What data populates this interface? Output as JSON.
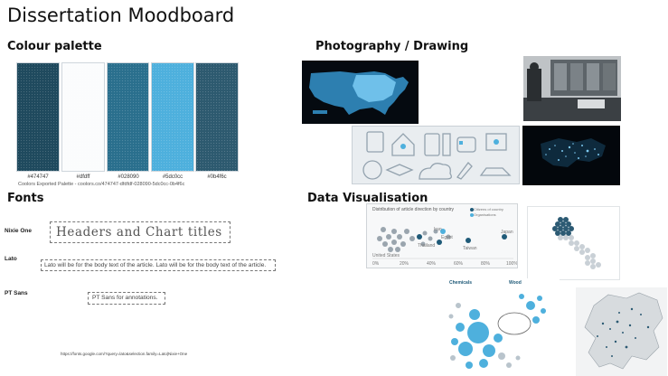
{
  "page": {
    "title": "Dissertation Moodboard"
  },
  "sections": {
    "colour_palette": "Colour palette",
    "photography": "Photography / Drawing",
    "fonts": "Fonts",
    "data_vis": "Data Visualisation"
  },
  "palette": {
    "swatches": [
      {
        "hex": "#1f4a5e",
        "label": "#474747"
      },
      {
        "hex": "#fbfcfd",
        "label": "#dfdff"
      },
      {
        "hex": "#2a6f8d",
        "label": "#028090"
      },
      {
        "hex": "#4eb0dd",
        "label": "#5dc0cc"
      },
      {
        "hex": "#2d5a6f",
        "label": "#0b4f6c"
      }
    ],
    "export_text": "Coolors Exported Palette - coolors.co/474747-dfdfdf-028090-5dc0cc-0b4f6c"
  },
  "fonts": [
    {
      "name": "Nixie One",
      "sample": "Headers and Chart titles"
    },
    {
      "name": "Lato",
      "sample": "Lato will be for the body text of the article. Lato will be for the body text of the article."
    },
    {
      "name": "PT Sans",
      "sample": "PT Sans for annotations."
    }
  ],
  "fonts_link": "https://fonts.google.com/?query=lato&selection.family=Lato|Nixie+One",
  "vis1": {
    "title": "Distribution of article direction by country",
    "legend": [
      "Citizens of country",
      "Organisations"
    ],
    "labels": [
      "United States",
      "Iran",
      "Egypt",
      "Thailand",
      "Taiwan",
      "Japan"
    ],
    "ticks": [
      "0%",
      "20%",
      "40%",
      "60%",
      "80%",
      "100%"
    ]
  },
  "vis3": {
    "title": "Chemicals",
    "title2": "Wood"
  }
}
